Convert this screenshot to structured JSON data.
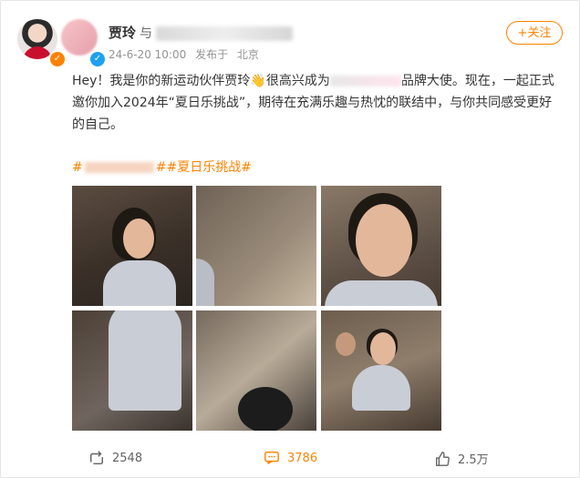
{
  "post": {
    "author_name": "贾玲",
    "with_text": "与",
    "timestamp": "24-6-20 10:00",
    "published_from_label": "发布于",
    "location": "北京",
    "follow_label": "+关注",
    "body": "Hey！我是你的新运动伙伴贾玲👋很高兴成为",
    "body_after_brand": "品牌大使。现在，一起正式邀你加入2024年“夏日乐挑战”，期待在充满乐趣与热忱的联结中，与你共同感受更好的自己。",
    "tag_prefix": "#",
    "tags_suffix": "##夏日乐挑战#"
  },
  "footer": {
    "reposts": "2548",
    "comments": "3786",
    "likes": "2.5万"
  },
  "icons": {
    "repost": "repost-icon",
    "comment": "comment-icon",
    "like": "like-icon",
    "verified": "verified-badge-icon"
  },
  "colors": {
    "accent": "#ff8200",
    "verified_blue": "#1da1f2",
    "text": "#333333",
    "meta": "#939393"
  }
}
